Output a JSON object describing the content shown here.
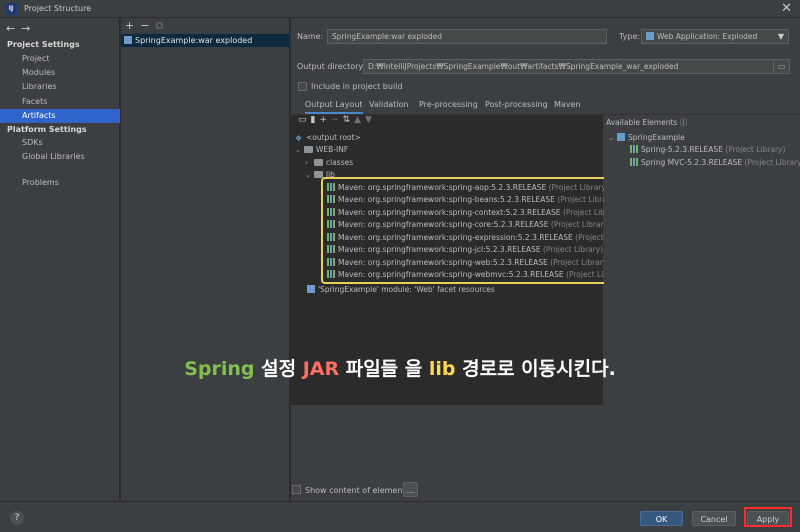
{
  "window": {
    "icon_text": "IJ",
    "title": "Project Structure"
  },
  "sidebar": {
    "sections": [
      {
        "title": "Project Settings",
        "items": [
          "Project",
          "Modules",
          "Libraries",
          "Facets",
          "Artifacts"
        ]
      },
      {
        "title": "Platform Settings",
        "items": [
          "SDKs",
          "Global Libraries"
        ]
      }
    ],
    "extra": "Problems",
    "selected": "Artifacts"
  },
  "artifacts_list": {
    "items": [
      "SpringExample:war exploded"
    ]
  },
  "artifact": {
    "name_label": "Name:",
    "name_value": "SpringExample:war exploded",
    "type_label": "Type:",
    "type_value": "Web Application: Exploded",
    "output_label": "Output directory:",
    "output_value": "D:₩IntelliJProjects₩SpringExample₩out₩artifacts₩SpringExample_war_exploded",
    "include_label": "Include in project build"
  },
  "tabs": [
    "Output Layout",
    "Validation",
    "Pre-processing",
    "Post-processing",
    "Maven"
  ],
  "active_tab": "Output Layout",
  "layout_tree": {
    "root": "<output root>",
    "web_inf": "WEB-INF",
    "classes": "classes",
    "lib": "lib",
    "libraries": [
      {
        "name": "Maven: org.springframework:spring-aop:5.2.3.RELEASE",
        "kind": "(Project Library)"
      },
      {
        "name": "Maven: org.springframework:spring-beans:5.2.3.RELEASE",
        "kind": "(Project Library)"
      },
      {
        "name": "Maven: org.springframework:spring-context:5.2.3.RELEASE",
        "kind": "(Project Library)"
      },
      {
        "name": "Maven: org.springframework:spring-core:5.2.3.RELEASE",
        "kind": "(Project Library)"
      },
      {
        "name": "Maven: org.springframework:spring-expression:5.2.3.RELEASE",
        "kind": "(Project Library)"
      },
      {
        "name": "Maven: org.springframework:spring-jcl:5.2.3.RELEASE",
        "kind": "(Project Library)"
      },
      {
        "name": "Maven: org.springframework:spring-web:5.2.3.RELEASE",
        "kind": "(Project Library)"
      },
      {
        "name": "Maven: org.springframework:spring-webmvc:5.2.3.RELEASE",
        "kind": "(Project Library)"
      }
    ],
    "facet_resources": "'SpringExample' module: 'Web' facet resources"
  },
  "available": {
    "header": "Available Elements",
    "root": "SpringExample",
    "items": [
      {
        "name": "Spring-5.2.3.RELEASE",
        "kind": "(Project Library)"
      },
      {
        "name": "Spring MVC-5.2.3.RELEASE",
        "kind": "(Project Library)"
      }
    ]
  },
  "overlay": {
    "p1": "Spring",
    "p2": " 설정 ",
    "p3": "JAR",
    "p4": " 파일들 을 ",
    "p5": "lib",
    "p6": " 경로로 이동시킨다."
  },
  "show_content_label": "Show content of elements",
  "ellipsis": "...",
  "buttons": {
    "help": "?",
    "ok": "OK",
    "cancel": "Cancel",
    "apply": "Apply"
  },
  "colors": {
    "accent": "#2f65ca",
    "highlight": "#e7cf5a",
    "apply_outline": "#ff2a2a"
  }
}
